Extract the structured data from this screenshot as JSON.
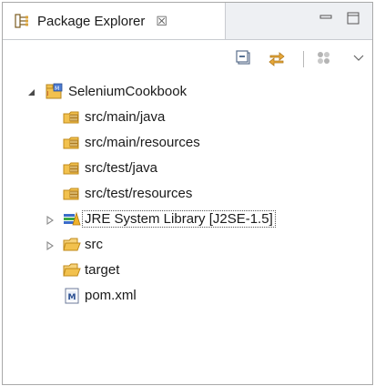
{
  "view": {
    "title": "Package Explorer",
    "tab_icon": "package-explorer-icon",
    "close_glyph": "☒",
    "minimize_icon": "minimize-icon",
    "maximize_icon": "maximize-icon"
  },
  "toolbar": {
    "collapse_all_icon": "collapse-all-icon",
    "link_with_editor_icon": "link-with-editor-icon",
    "focus_icon": "focus-on-active-task-icon",
    "view_menu_icon": "view-menu-chevron-icon"
  },
  "tree": {
    "project": {
      "label": "SeleniumCookbook",
      "icon": "maven-project-icon",
      "expanded": true
    },
    "items": [
      {
        "label": "src/main/java",
        "icon": "source-folder-icon",
        "twisty": "none"
      },
      {
        "label": "src/main/resources",
        "icon": "source-folder-icon",
        "twisty": "none"
      },
      {
        "label": "src/test/java",
        "icon": "source-folder-icon",
        "twisty": "none"
      },
      {
        "label": "src/test/resources",
        "icon": "source-folder-icon",
        "twisty": "none"
      },
      {
        "label": "JRE System Library [J2SE-1.5]",
        "icon": "library-icon",
        "twisty": "collapsed",
        "focused": true
      },
      {
        "label": "src",
        "icon": "folder-icon",
        "twisty": "collapsed"
      },
      {
        "label": "target",
        "icon": "folder-icon",
        "twisty": "none"
      },
      {
        "label": "pom.xml",
        "icon": "maven-pom-icon",
        "twisty": "none"
      }
    ]
  },
  "colors": {
    "folder_yellow": "#f2c14e",
    "folder_stroke": "#c08a1a",
    "library_green": "#3aa845",
    "library_blue": "#3b6cc9",
    "twisty_gray": "#8a8a8a"
  }
}
